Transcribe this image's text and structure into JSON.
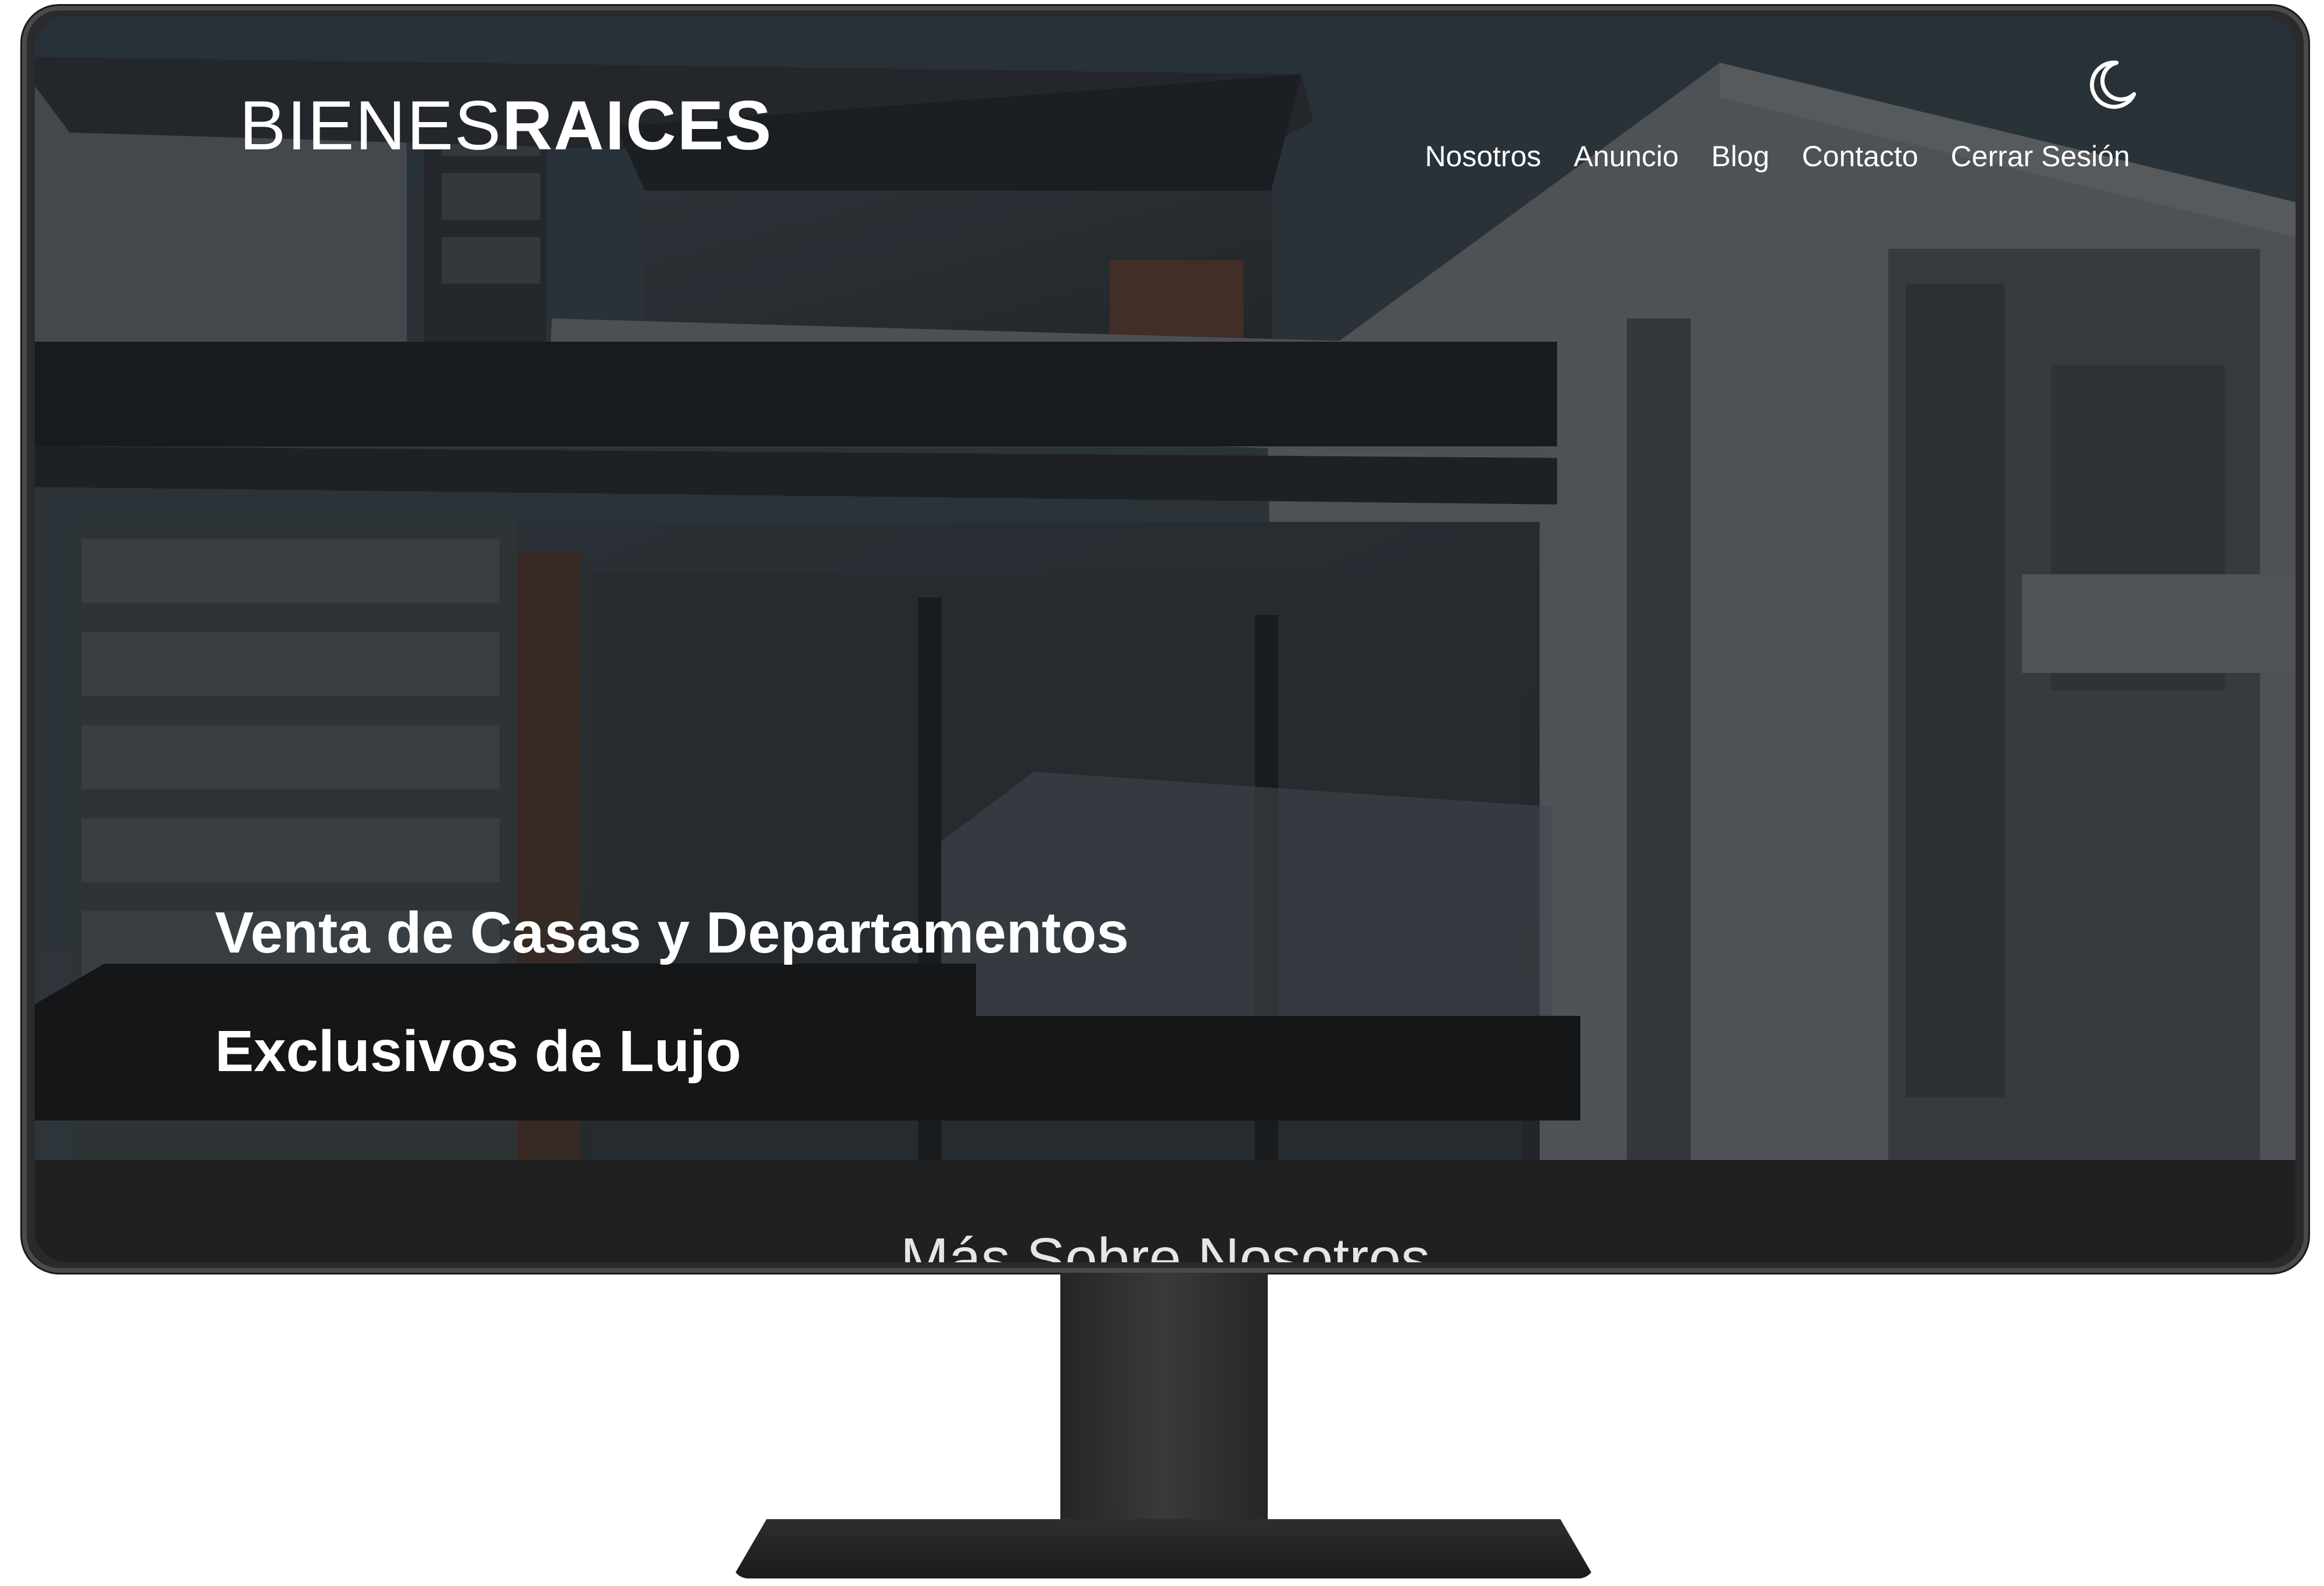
{
  "brand": {
    "logo_light": "BIENES",
    "logo_bold": "RAICES"
  },
  "theme_toggle": {
    "icon": "moon-icon"
  },
  "nav": {
    "items": [
      {
        "label": "Nosotros"
      },
      {
        "label": "Anuncio"
      },
      {
        "label": "Blog"
      },
      {
        "label": "Contacto"
      },
      {
        "label": "Cerrar Sesión"
      }
    ]
  },
  "hero": {
    "title_line1": "Venta de Casas y Departamentos",
    "title_line2": "Exclusivos de Lujo"
  },
  "section": {
    "title": "Más Sobre Nosotros"
  },
  "colors": {
    "text": "#ffffff",
    "overlay": "#14161a",
    "section_bg": "#202021",
    "frame": "#4a4a4d"
  }
}
